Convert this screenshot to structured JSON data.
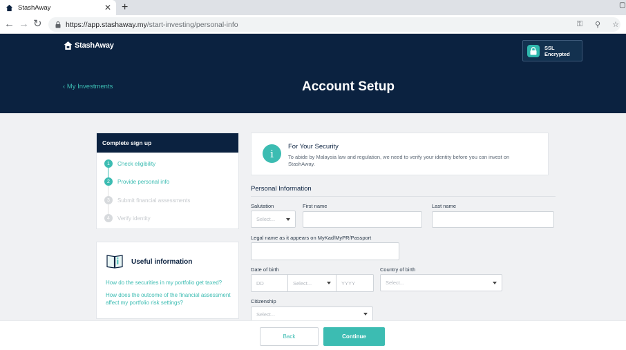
{
  "browser": {
    "tab_title": "StashAway",
    "tab_close": "✕",
    "new_tab": "+",
    "url_host": "https://app.stashaway.my",
    "url_path": "/start-investing/personal-info"
  },
  "header": {
    "logo_text": "StashAway",
    "ssl_line1": "SSL",
    "ssl_line2": "Encrypted",
    "back_link": "My Investments",
    "title": "Account Setup"
  },
  "steps": {
    "heading": "Complete sign up",
    "items": [
      {
        "num": "1",
        "label": "Check eligibility"
      },
      {
        "num": "2",
        "label": "Provide personal info"
      },
      {
        "num": "3",
        "label": "Submit financial assessments"
      },
      {
        "num": "4",
        "label": "Verify identity"
      }
    ]
  },
  "useful": {
    "title": "Useful information",
    "links": [
      "How do the securities in my portfolio get taxed?",
      "How does the outcome of the financial assessment affect my portfolio risk settings?"
    ]
  },
  "notice": {
    "icon": "i",
    "title": "For Your Security",
    "body": "To abide by Malaysia law and regulation, we need to verify your identity before you can invest on StashAway."
  },
  "form": {
    "section_title": "Personal Information",
    "salutation_label": "Salutation",
    "salutation_placeholder": "Select...",
    "first_name_label": "First name",
    "last_name_label": "Last name",
    "legal_name_label": "Legal name as it appears on MyKad/MyPR/Passport",
    "dob_label": "Date of birth",
    "dob_day_placeholder": "DD",
    "dob_month_placeholder": "Select...",
    "dob_year_placeholder": "YYYY",
    "country_label": "Country of birth",
    "country_placeholder": "Select...",
    "citizenship_label": "Citizenship",
    "citizenship_placeholder": "Select..."
  },
  "actions": {
    "back": "Back",
    "continue": "Continue"
  },
  "colors": {
    "navy": "#0b2240",
    "teal": "#3cbcb2"
  }
}
